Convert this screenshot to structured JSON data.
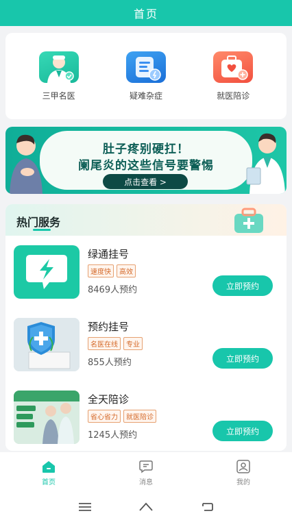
{
  "header": {
    "title": "首页"
  },
  "quick_entries": [
    {
      "label": "三甲名医",
      "icon": "doctor-icon"
    },
    {
      "label": "疑难杂症",
      "icon": "document-icon"
    },
    {
      "label": "就医陪诊",
      "icon": "medical-kit-icon"
    }
  ],
  "banner": {
    "line1": "肚子疼别硬扛！",
    "line2": "阑尾炎的这些信号要警惕",
    "button": "点击查看 >"
  },
  "services": {
    "title": "热门服务",
    "items": [
      {
        "name": "绿通挂号",
        "tags": [
          "速度快",
          "高效"
        ],
        "count": "8469人预约",
        "button": "立即预约"
      },
      {
        "name": "预约挂号",
        "tags": [
          "名医在线",
          "专业"
        ],
        "count": "855人预约",
        "button": "立即预约"
      },
      {
        "name": "全天陪诊",
        "tags": [
          "省心省力",
          "就医陪诊"
        ],
        "count": "1245人预约",
        "button": "立即预约"
      }
    ]
  },
  "tabbar": [
    {
      "label": "首页",
      "icon": "home-icon",
      "active": true
    },
    {
      "label": "消息",
      "icon": "message-icon",
      "active": false
    },
    {
      "label": "我的",
      "icon": "profile-icon",
      "active": false
    }
  ],
  "colors": {
    "brand": "#18c6ab",
    "tag": "#d46a2a"
  }
}
